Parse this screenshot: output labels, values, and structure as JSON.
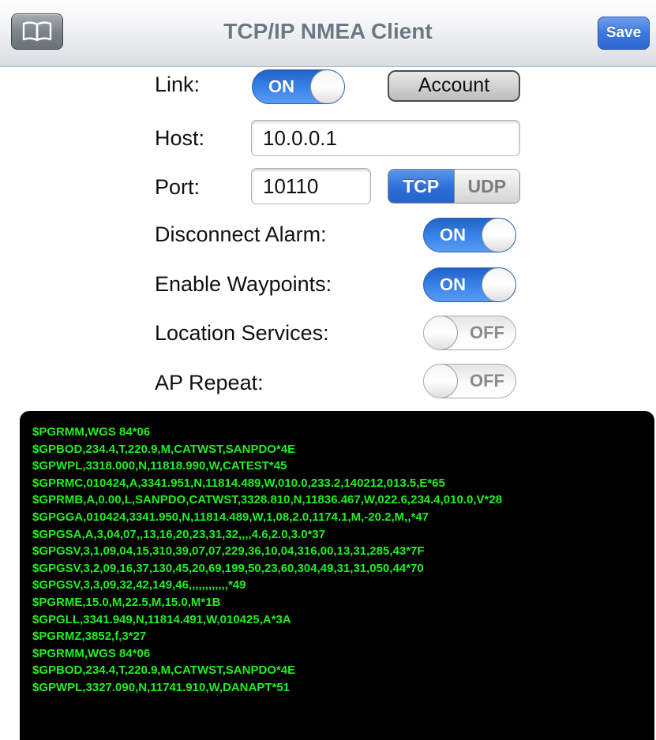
{
  "navbar": {
    "title": "TCP/IP NMEA Client",
    "save_label": "Save",
    "bookmarks_icon": "open-book-icon"
  },
  "form": {
    "link": {
      "label": "Link:",
      "state": "ON"
    },
    "account_label": "Account",
    "host": {
      "label": "Host:",
      "value": "10.0.0.1"
    },
    "port": {
      "label": "Port:",
      "value": "10110"
    },
    "protocol": {
      "options": [
        "TCP",
        "UDP"
      ],
      "selected": "TCP"
    },
    "disconnect_alarm": {
      "label": "Disconnect Alarm:",
      "state": "ON"
    },
    "enable_waypoints": {
      "label": "Enable Waypoints:",
      "state": "ON"
    },
    "location_services": {
      "label": "Location Services:",
      "state": "OFF"
    },
    "ap_repeat": {
      "label": "AP Repeat:",
      "state": "OFF"
    }
  },
  "log": {
    "lines": [
      "$PGRMM,WGS 84*06",
      "$GPBOD,234.4,T,220.9,M,CATWST,SANPDO*4E",
      "$GPWPL,3318.000,N,11818.990,W,CATEST*45",
      "$GPRMC,010424,A,3341.951,N,11814.489,W,010.0,233.2,140212,013.5,E*65",
      "$GPRMB,A,0.00,L,SANPDO,CATWST,3328.810,N,11836.467,W,022.6,234.4,010.0,V*28",
      "$GPGGA,010424,3341.950,N,11814.489,W,1,08,2.0,1174.1,M,-20.2,M,,*47",
      "$GPGSA,A,3,04,07,,13,16,20,23,31,32,,,,4.6,2.0,3.0*37",
      "$GPGSV,3,1,09,04,15,310,39,07,07,229,36,10,04,316,00,13,31,285,43*7F",
      "$GPGSV,3,2,09,16,37,130,45,20,69,199,50,23,60,304,49,31,31,050,44*70",
      "$GPGSV,3,3,09,32,42,149,46,,,,,,,,,,,,*49",
      "$PGRME,15.0,M,22.5,M,15.0,M*1B",
      "$GPGLL,3341.949,N,11814.491,W,010425,A*3A",
      "$PGRMZ,3852,f,3*27",
      "$PGRMM,WGS 84*06",
      "$GPBOD,234.4,T,220.9,M,CATWST,SANPDO*4E",
      "$GPWPL,3327.090,N,11741.910,W,DANAPT*51"
    ],
    "text_color": "#22ee22",
    "background": "#000000"
  },
  "colors": {
    "switch_on": "#3a84ea",
    "nav_title": "#6d7885",
    "save_button": "#3a78e0"
  }
}
